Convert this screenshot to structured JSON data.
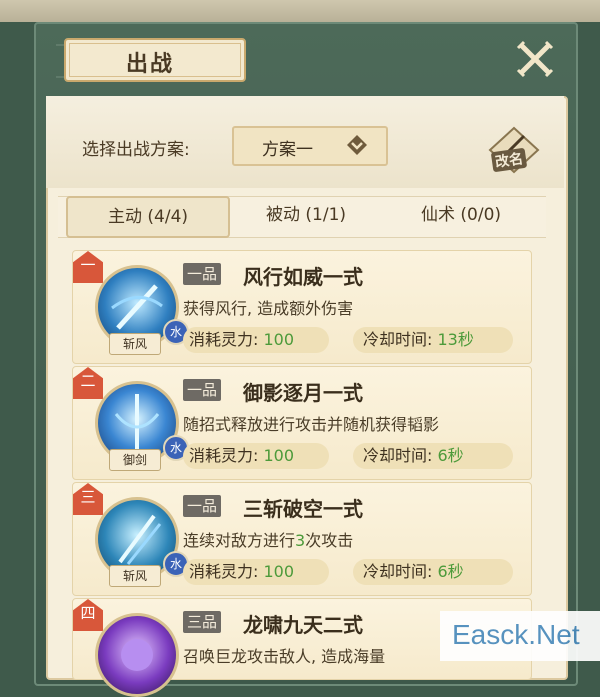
{
  "window": {
    "title": "出战"
  },
  "scheme": {
    "label": "选择出战方案:",
    "selected": "方案一",
    "rename_label": "改名"
  },
  "tabs": [
    {
      "label": "主动 (4/4)",
      "active": true
    },
    {
      "label": "被动 (1/1)",
      "active": false
    },
    {
      "label": "仙术 (0/0)",
      "active": false
    }
  ],
  "skills": [
    {
      "rank": "一",
      "icon_label": "斩风",
      "element": "水",
      "grade": "一品",
      "name": "风行如威一式",
      "desc": "获得风行, 造成额外伤害",
      "cost_label": "消耗灵力:",
      "cost": "100",
      "cd_label": "冷却时间:",
      "cd": "13秒"
    },
    {
      "rank": "二",
      "icon_label": "御剑",
      "element": "水",
      "grade": "一品",
      "name": "御影逐月一式",
      "desc": "随招式释放进行攻击并随机获得韬影",
      "cost_label": "消耗灵力:",
      "cost": "100",
      "cd_label": "冷却时间:",
      "cd": "6秒"
    },
    {
      "rank": "三",
      "icon_label": "斩风",
      "element": "水",
      "grade": "一品",
      "name": "三斩破空一式",
      "desc_pre": "连续对敌方进行",
      "desc_num": "3",
      "desc_post": "次攻击",
      "cost_label": "消耗灵力:",
      "cost": "100",
      "cd_label": "冷却时间:",
      "cd": "6秒"
    },
    {
      "rank": "四",
      "grade": "三品",
      "name": "龙啸九天二式",
      "desc": "召唤巨龙攻击敌人, 造成海量"
    }
  ],
  "watermark": "Easck.Net",
  "colors": {
    "accent_green": "#4c9a3a",
    "frame": "#3f5a4b",
    "rank_red": "#d8573a"
  }
}
